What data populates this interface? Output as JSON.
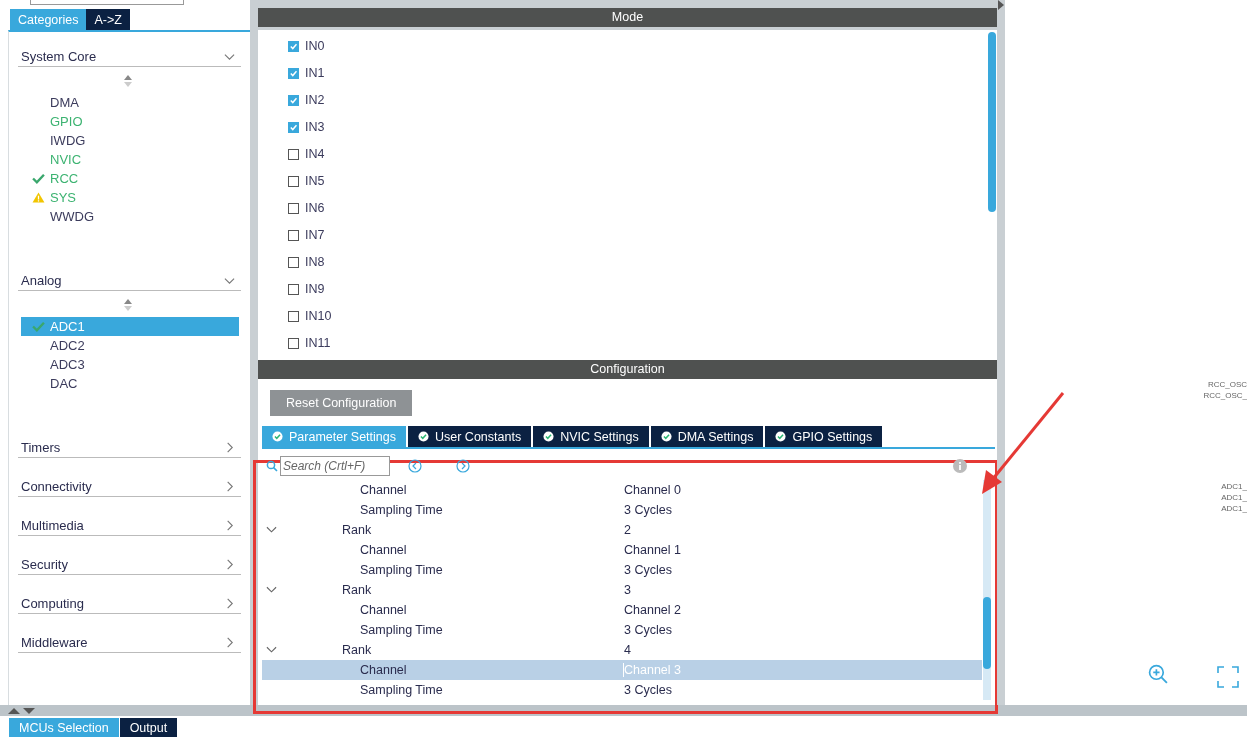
{
  "sidebar": {
    "tabs": [
      {
        "label": "Categories",
        "selected": true
      },
      {
        "label": "A->Z",
        "selected": false
      }
    ],
    "categories": [
      {
        "name": "System Core",
        "expanded": true,
        "items": [
          {
            "label": "DMA",
            "kind": "plain",
            "selected": false
          },
          {
            "label": "GPIO",
            "kind": "enabled",
            "selected": false
          },
          {
            "label": "IWDG",
            "kind": "plain",
            "selected": false
          },
          {
            "label": "NVIC",
            "kind": "enabled",
            "selected": false
          },
          {
            "label": "RCC",
            "kind": "ok",
            "selected": false
          },
          {
            "label": "SYS",
            "kind": "warning",
            "selected": false
          },
          {
            "label": "WWDG",
            "kind": "plain",
            "selected": false
          }
        ]
      },
      {
        "name": "Analog",
        "expanded": true,
        "items": [
          {
            "label": "ADC1",
            "kind": "ok",
            "selected": true
          },
          {
            "label": "ADC2",
            "kind": "plain",
            "selected": false
          },
          {
            "label": "ADC3",
            "kind": "plain",
            "selected": false
          },
          {
            "label": "DAC",
            "kind": "plain",
            "selected": false
          }
        ]
      },
      {
        "name": "Timers",
        "expanded": false
      },
      {
        "name": "Connectivity",
        "expanded": false
      },
      {
        "name": "Multimedia",
        "expanded": false
      },
      {
        "name": "Security",
        "expanded": false
      },
      {
        "name": "Computing",
        "expanded": false
      },
      {
        "name": "Middleware",
        "expanded": false
      }
    ]
  },
  "mode": {
    "title": "Mode",
    "inputs": [
      {
        "label": "IN0",
        "checked": true
      },
      {
        "label": "IN1",
        "checked": true
      },
      {
        "label": "IN2",
        "checked": true
      },
      {
        "label": "IN3",
        "checked": true
      },
      {
        "label": "IN4",
        "checked": false
      },
      {
        "label": "IN5",
        "checked": false
      },
      {
        "label": "IN6",
        "checked": false
      },
      {
        "label": "IN7",
        "checked": false
      },
      {
        "label": "IN8",
        "checked": false
      },
      {
        "label": "IN9",
        "checked": false
      },
      {
        "label": "IN10",
        "checked": false
      },
      {
        "label": "IN11",
        "checked": false
      }
    ]
  },
  "configuration": {
    "title": "Configuration",
    "reset_button": "Reset Configuration",
    "tabs": [
      {
        "label": "Parameter Settings",
        "selected": true
      },
      {
        "label": "User Constants",
        "selected": false
      },
      {
        "label": "NVIC Settings",
        "selected": false
      },
      {
        "label": "DMA Settings",
        "selected": false
      },
      {
        "label": "GPIO Settings",
        "selected": false
      }
    ],
    "search": {
      "placeholder": "Search (Crtl+F)"
    },
    "tree": [
      {
        "children": [
          {
            "name": "Channel",
            "value": "Channel 0",
            "selected": false
          },
          {
            "name": "Sampling Time",
            "value": "3 Cycles",
            "selected": false
          }
        ]
      },
      {
        "name": "Rank",
        "value": "2",
        "expanded": true,
        "children": [
          {
            "name": "Channel",
            "value": "Channel 1",
            "selected": false
          },
          {
            "name": "Sampling Time",
            "value": "3 Cycles",
            "selected": false
          }
        ]
      },
      {
        "name": "Rank",
        "value": "3",
        "expanded": true,
        "children": [
          {
            "name": "Channel",
            "value": "Channel 2",
            "selected": false
          },
          {
            "name": "Sampling Time",
            "value": "3 Cycles",
            "selected": false
          }
        ]
      },
      {
        "name": "Rank",
        "value": "4",
        "expanded": true,
        "children": [
          {
            "name": "Channel",
            "value": "Channel 3",
            "selected": true
          },
          {
            "name": "Sampling Time",
            "value": "3 Cycles",
            "selected": false
          }
        ]
      }
    ]
  },
  "pinout": {
    "pin_labels": [
      "RCC_OSC",
      "RCC_OSC_",
      "ADC1_",
      "ADC1_",
      "ADC1_"
    ]
  },
  "bottom_tabs": [
    {
      "label": "MCUs Selection",
      "selected": true
    },
    {
      "label": "Output",
      "selected": false
    }
  ]
}
